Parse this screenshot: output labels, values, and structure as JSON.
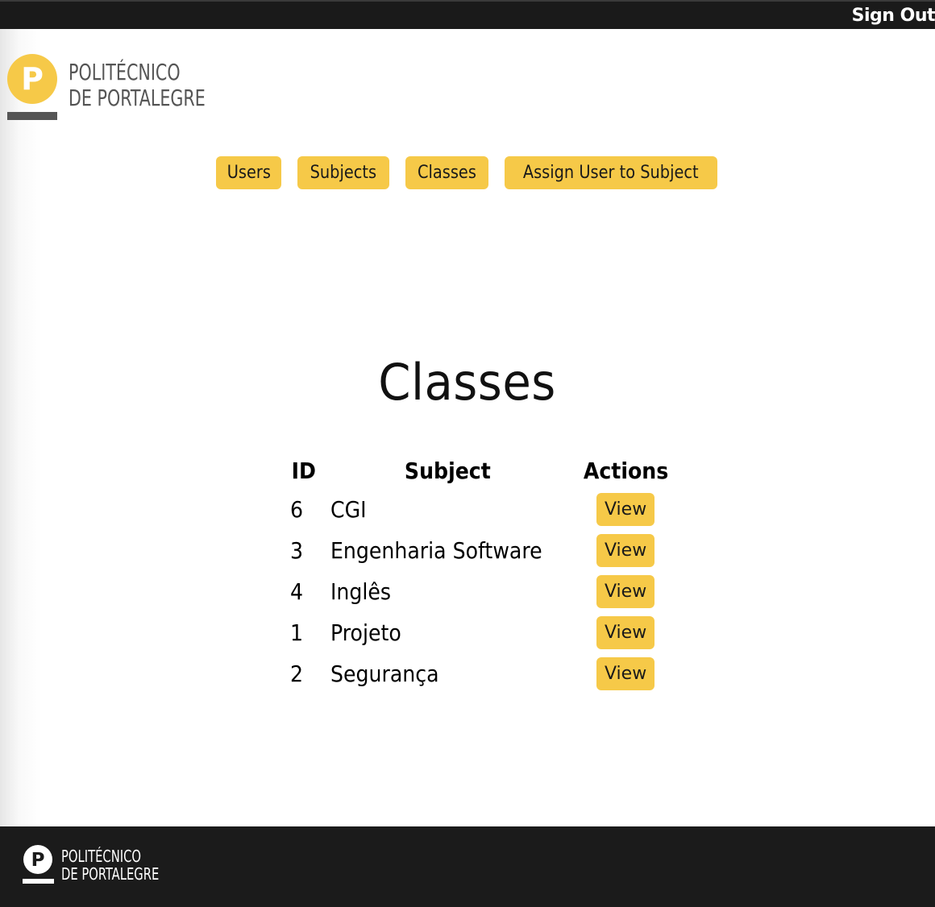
{
  "header": {
    "sign_out_label": "Sign Out"
  },
  "brand": {
    "line1": "POLITÉCNICO",
    "line2": "DE PORTALEGRE",
    "logo_letter": "P",
    "accent_color": "#f6c948"
  },
  "nav": {
    "items": [
      {
        "label": "Users"
      },
      {
        "label": "Subjects"
      },
      {
        "label": "Classes"
      },
      {
        "label": "Assign User to Subject"
      }
    ]
  },
  "page": {
    "title": "Classes"
  },
  "table": {
    "columns": [
      "ID",
      "Subject",
      "Actions"
    ],
    "rows": [
      {
        "id": "6",
        "subject": "CGI",
        "action": "View"
      },
      {
        "id": "3",
        "subject": "Engenharia Software",
        "action": "View"
      },
      {
        "id": "4",
        "subject": "Inglês",
        "action": "View"
      },
      {
        "id": "1",
        "subject": "Projeto",
        "action": "View"
      },
      {
        "id": "2",
        "subject": "Segurança",
        "action": "View"
      }
    ]
  },
  "footer": {
    "line1": "POLITÉCNICO",
    "line2": "DE PORTALEGRE",
    "logo_letter": "P"
  }
}
